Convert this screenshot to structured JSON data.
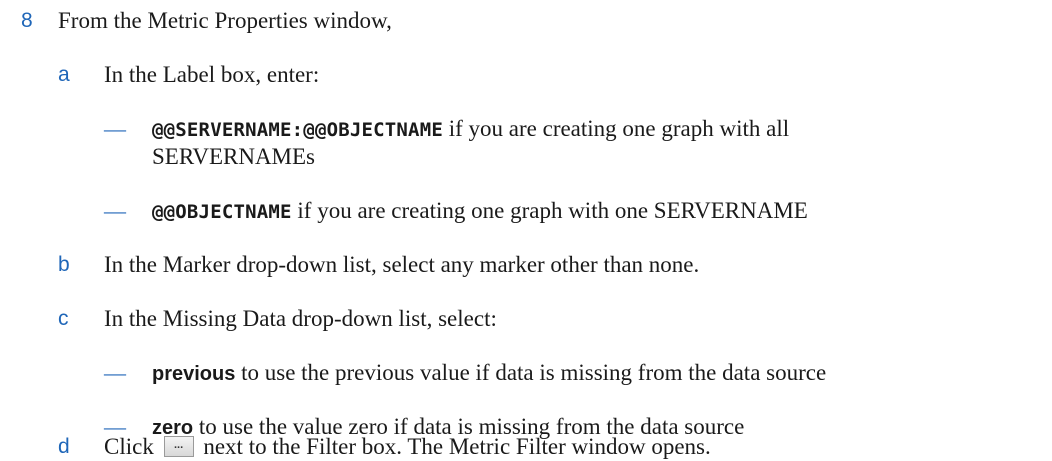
{
  "step8": {
    "number": "8",
    "text": "From the Metric Properties window,"
  },
  "a": {
    "letter": "a",
    "text": "In the Label box, enter:",
    "items": [
      {
        "code": "@@SERVERNAME:@@OBJECTNAME",
        "text": " if you are creating one graph with all",
        "text2": "SERVERNAMEs"
      },
      {
        "code": "@@OBJECTNAME",
        "text": " if you are creating one graph with one SERVERNAME"
      }
    ]
  },
  "b": {
    "letter": "b",
    "text": "In the Marker drop-down list, select any marker other than none."
  },
  "c": {
    "letter": "c",
    "text": "In the Missing Data drop-down list, select:",
    "items": [
      {
        "ui": "previous",
        "text": " to use the previous value if data is missing from the data source"
      },
      {
        "ui": "zero",
        "text": " to use the value zero if data is missing from the data source"
      }
    ]
  },
  "d": {
    "letter": "d",
    "pre": "Click",
    "button_label": "...",
    "post": "next to the Filter box. The Metric Filter window opens."
  },
  "dash": "—"
}
